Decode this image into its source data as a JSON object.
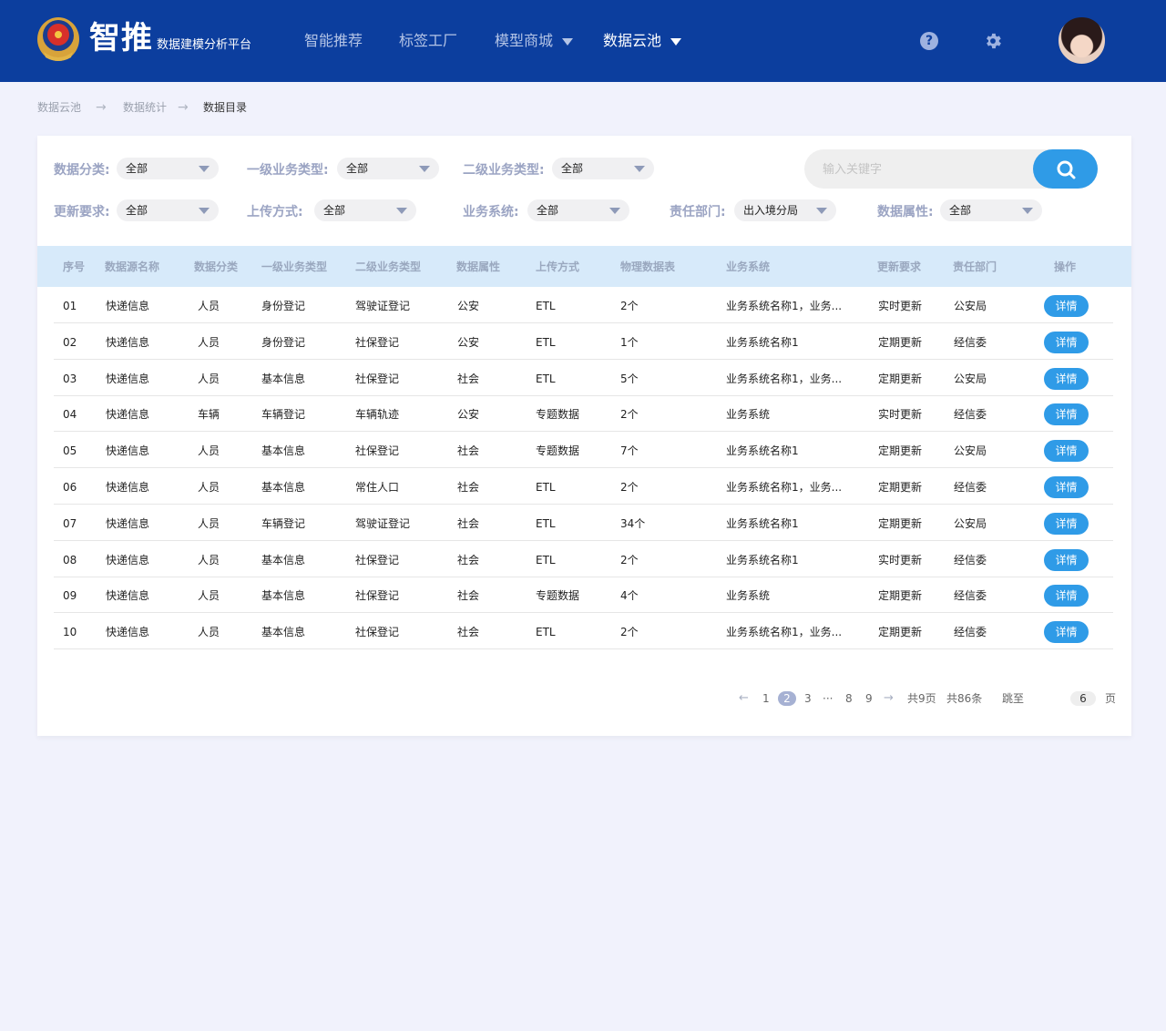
{
  "header": {
    "brand_name": "智推",
    "brand_subtitle": "数据建模分析平台",
    "nav": [
      {
        "label": "智能推荐",
        "active": false,
        "dropdown": false
      },
      {
        "label": "标签工厂",
        "active": false,
        "dropdown": false
      },
      {
        "label": "模型商城",
        "active": false,
        "dropdown": true
      },
      {
        "label": "数据云池",
        "active": true,
        "dropdown": true
      }
    ],
    "help_icon": "help-icon",
    "settings_icon": "gear-icon",
    "colors": {
      "bar": "#0c3e9e",
      "accent": "#2f9be7"
    }
  },
  "breadcrumb": [
    "数据云池",
    "数据统计",
    "数据目录"
  ],
  "filters": [
    {
      "label": "数据分类:",
      "value": "全部"
    },
    {
      "label": "一级业务类型:",
      "value": "全部"
    },
    {
      "label": "二级业务类型:",
      "value": "全部"
    },
    {
      "label": "更新要求:",
      "value": "全部"
    },
    {
      "label": "上传方式:",
      "value": "全部"
    },
    {
      "label": "业务系统:",
      "value": "全部"
    },
    {
      "label": "责任部门:",
      "value": "出入境分局"
    },
    {
      "label": "数据属性:",
      "value": "全部"
    }
  ],
  "search": {
    "placeholder": "输入关键字"
  },
  "table": {
    "columns": [
      "序号",
      "数据源名称",
      "数据分类",
      "一级业务类型",
      "二级业务类型",
      "数据属性",
      "上传方式",
      "物理数据表",
      "业务系统",
      "更新要求",
      "责任部门",
      "操作"
    ],
    "action_label": "详情",
    "rows": [
      [
        "01",
        "快递信息",
        "人员",
        "身份登记",
        "驾驶证登记",
        "公安",
        "ETL",
        "2个",
        "业务系统名称1，业务...",
        "实时更新",
        "公安局"
      ],
      [
        "02",
        "快递信息",
        "人员",
        "身份登记",
        "社保登记",
        "公安",
        "ETL",
        "1个",
        "业务系统名称1",
        "定期更新",
        "经信委"
      ],
      [
        "03",
        "快递信息",
        "人员",
        "基本信息",
        "社保登记",
        "社会",
        "ETL",
        "5个",
        "业务系统名称1，业务...",
        "定期更新",
        "公安局"
      ],
      [
        "04",
        "快递信息",
        "车辆",
        "车辆登记",
        "车辆轨迹",
        "公安",
        "专题数据",
        "2个",
        "业务系统",
        "实时更新",
        "经信委"
      ],
      [
        "05",
        "快递信息",
        "人员",
        "基本信息",
        "社保登记",
        "社会",
        "专题数据",
        "7个",
        "业务系统名称1",
        "定期更新",
        "公安局"
      ],
      [
        "06",
        "快递信息",
        "人员",
        "基本信息",
        "常住人口",
        "社会",
        "ETL",
        "2个",
        "业务系统名称1，业务...",
        "定期更新",
        "经信委"
      ],
      [
        "07",
        "快递信息",
        "人员",
        "车辆登记",
        "驾驶证登记",
        "社会",
        "ETL",
        "34个",
        "业务系统名称1",
        "定期更新",
        "公安局"
      ],
      [
        "08",
        "快递信息",
        "人员",
        "基本信息",
        "社保登记",
        "社会",
        "ETL",
        "2个",
        "业务系统名称1",
        "实时更新",
        "经信委"
      ],
      [
        "09",
        "快递信息",
        "人员",
        "基本信息",
        "社保登记",
        "社会",
        "专题数据",
        "4个",
        "业务系统",
        "定期更新",
        "经信委"
      ],
      [
        "10",
        "快递信息",
        "人员",
        "基本信息",
        "社保登记",
        "社会",
        "ETL",
        "2个",
        "业务系统名称1，业务...",
        "定期更新",
        "经信委"
      ]
    ]
  },
  "pagination": {
    "prev": "←",
    "pages": [
      "1",
      "2",
      "3",
      "···",
      "8",
      "9"
    ],
    "current_page": "2",
    "next": "→",
    "total_pages": "共9页",
    "total_items": "共86条",
    "jump_label": "跳至",
    "jump_value": "6",
    "page_unit": "页"
  }
}
